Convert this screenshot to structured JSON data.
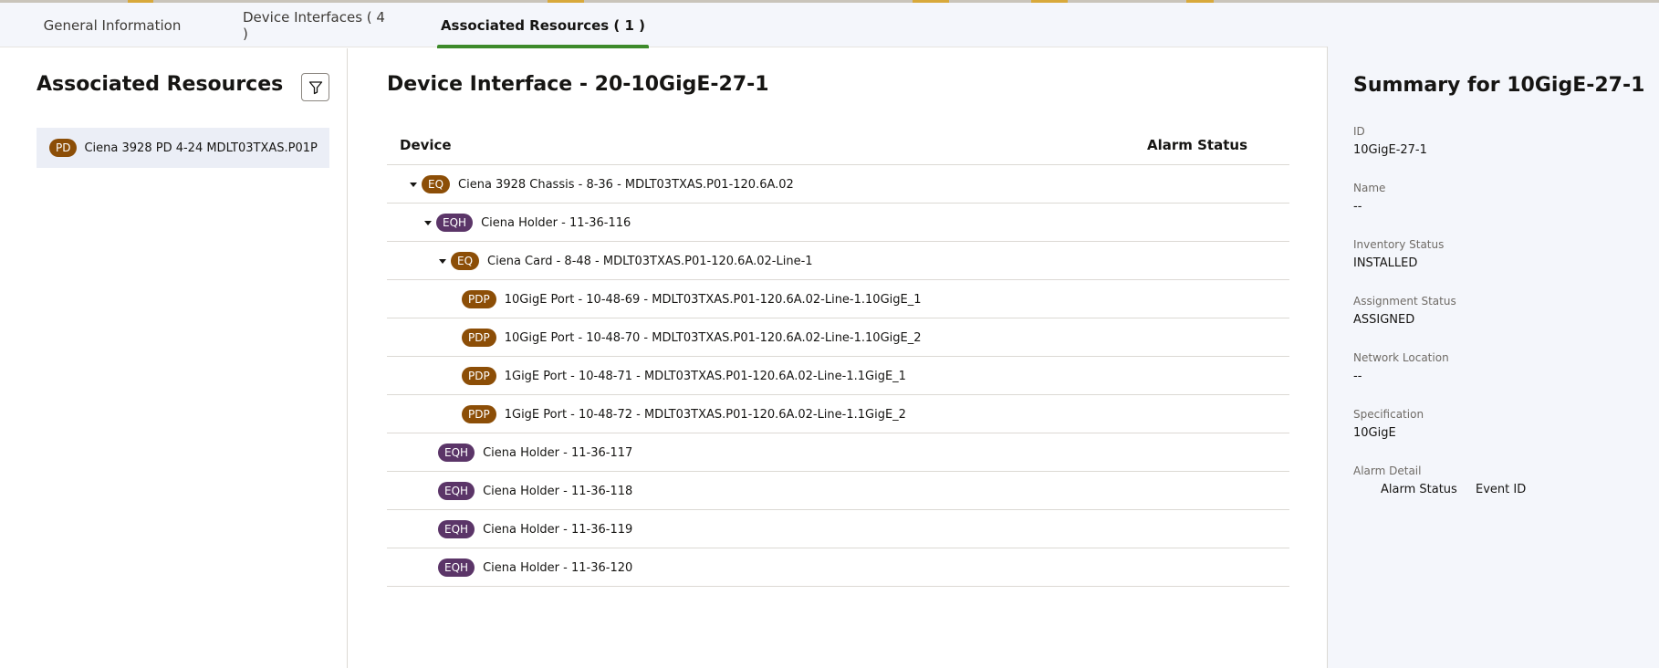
{
  "colors": {
    "tab_active_underline": "#3d8a2a",
    "badge_brown": "#8c4e07",
    "badge_purple": "#5b3568",
    "selected_item_bg": "#ebeef6",
    "summary_bg": "#f4f6fb"
  },
  "tabs": [
    {
      "label": "General Information",
      "active": false
    },
    {
      "label": "Device Interfaces ( 4 )",
      "active": false
    },
    {
      "label": "Associated Resources ( 1 )",
      "active": true
    }
  ],
  "left": {
    "title": "Associated Resources",
    "filter_icon": "filter-icon",
    "items": [
      {
        "badge": "PD",
        "label": "Ciena 3928 PD 4-24 MDLT03TXAS.P01P",
        "selected": true
      }
    ]
  },
  "main": {
    "title": "Device Interface - 20-10GigE-27-1",
    "columns": {
      "device": "Device",
      "alarm_status": "Alarm Status"
    },
    "rows": [
      {
        "level": 0,
        "expanded": true,
        "badge": "EQ",
        "badge_color": "brown",
        "label": "Ciena 3928 Chassis - 8-36 - MDLT03TXAS.P01-120.6A.02"
      },
      {
        "level": 1,
        "expanded": true,
        "badge": "EQH",
        "badge_color": "purple",
        "label": "Ciena Holder - 11-36-116"
      },
      {
        "level": 2,
        "expanded": true,
        "badge": "EQ",
        "badge_color": "brown",
        "label": "Ciena Card - 8-48 - MDLT03TXAS.P01-120.6A.02-Line-1"
      },
      {
        "level": 3,
        "expanded": null,
        "badge": "PDP",
        "badge_color": "brown",
        "label": "10GigE Port - 10-48-69 - MDLT03TXAS.P01-120.6A.02-Line-1.10GigE_1"
      },
      {
        "level": 3,
        "expanded": null,
        "badge": "PDP",
        "badge_color": "brown",
        "label": "10GigE Port - 10-48-70 - MDLT03TXAS.P01-120.6A.02-Line-1.10GigE_2"
      },
      {
        "level": 3,
        "expanded": null,
        "badge": "PDP",
        "badge_color": "brown",
        "label": "1GigE Port - 10-48-71 - MDLT03TXAS.P01-120.6A.02-Line-1.1GigE_1"
      },
      {
        "level": 3,
        "expanded": null,
        "badge": "PDP",
        "badge_color": "brown",
        "label": "1GigE Port - 10-48-72 - MDLT03TXAS.P01-120.6A.02-Line-1.1GigE_2"
      },
      {
        "level": 1,
        "expanded": null,
        "badge": "EQH",
        "badge_color": "purple",
        "label": "Ciena Holder - 11-36-117"
      },
      {
        "level": 1,
        "expanded": null,
        "badge": "EQH",
        "badge_color": "purple",
        "label": "Ciena Holder - 11-36-118"
      },
      {
        "level": 1,
        "expanded": null,
        "badge": "EQH",
        "badge_color": "purple",
        "label": "Ciena Holder - 11-36-119"
      },
      {
        "level": 1,
        "expanded": null,
        "badge": "EQH",
        "badge_color": "purple",
        "label": "Ciena Holder - 11-36-120"
      }
    ]
  },
  "summary": {
    "title": "Summary for 10GigE-27-1",
    "fields": [
      {
        "label": "ID",
        "value": "10GigE-27-1"
      },
      {
        "label": "Name",
        "value": "--"
      },
      {
        "label": "Inventory Status",
        "value": "INSTALLED"
      },
      {
        "label": "Assignment Status",
        "value": "ASSIGNED"
      },
      {
        "label": "Network Location",
        "value": "--"
      },
      {
        "label": "Specification",
        "value": "10GigE"
      }
    ],
    "alarm_detail": {
      "label": "Alarm Detail",
      "columns": [
        "Alarm Status",
        "Event ID"
      ]
    }
  }
}
